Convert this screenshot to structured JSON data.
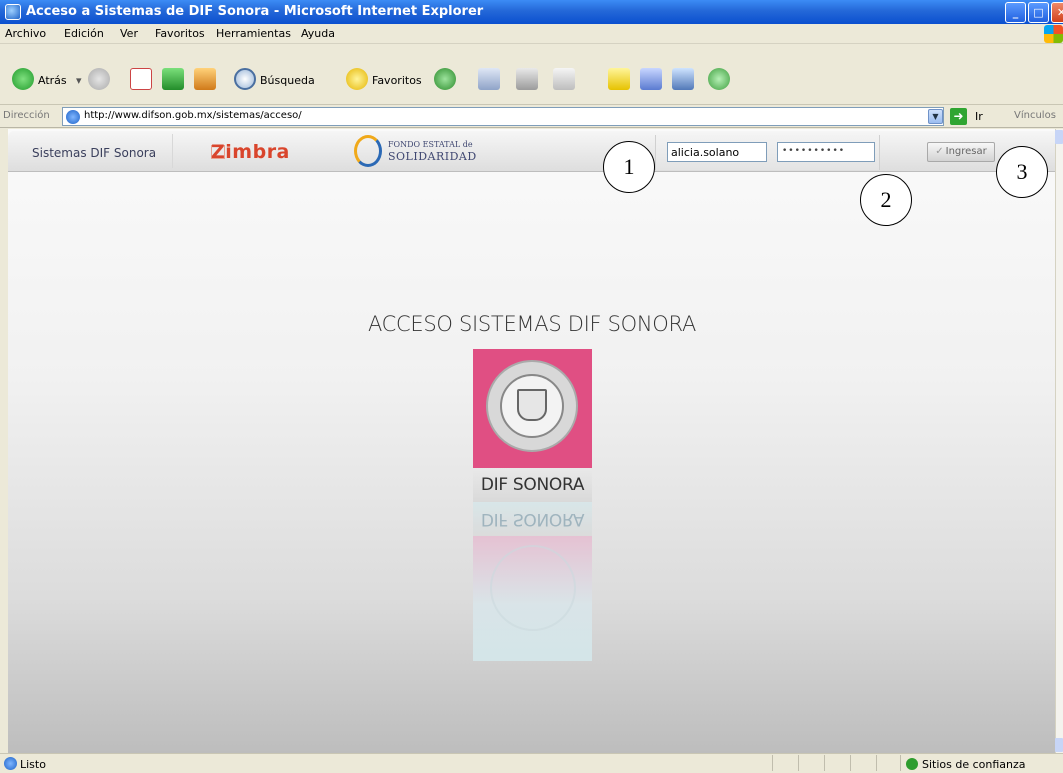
{
  "window": {
    "title": "Acceso a Sistemas de DIF Sonora - Microsoft Internet Explorer"
  },
  "menu": [
    "Archivo",
    "Edición",
    "Ver",
    "Favoritos",
    "Herramientas",
    "Ayuda"
  ],
  "toolbar": {
    "back": "Atrás",
    "search": "Búsqueda",
    "favorites": "Favoritos"
  },
  "address": {
    "label": "Dirección",
    "url": "http://www.difson.gob.mx/sistemas/acceso/",
    "go": "Ir",
    "links": "Vínculos"
  },
  "nav": {
    "sistemas": "Sistemas DIF Sonora",
    "zimbra": "Zimbra",
    "fondo_line1": "FONDO ESTATAL de",
    "fondo_line2": "SOLIDARIDAD"
  },
  "login": {
    "username": "alicia.solano",
    "password_mask": "••••••••••",
    "submit": "Ingresar"
  },
  "callouts": [
    "1",
    "2",
    "3"
  ],
  "main": {
    "title": "ACCESO SISTEMAS DIF SONORA",
    "logo_label": "DIF SONORA"
  },
  "status": {
    "text": "Listo",
    "zone": "Sitios de confianza"
  }
}
